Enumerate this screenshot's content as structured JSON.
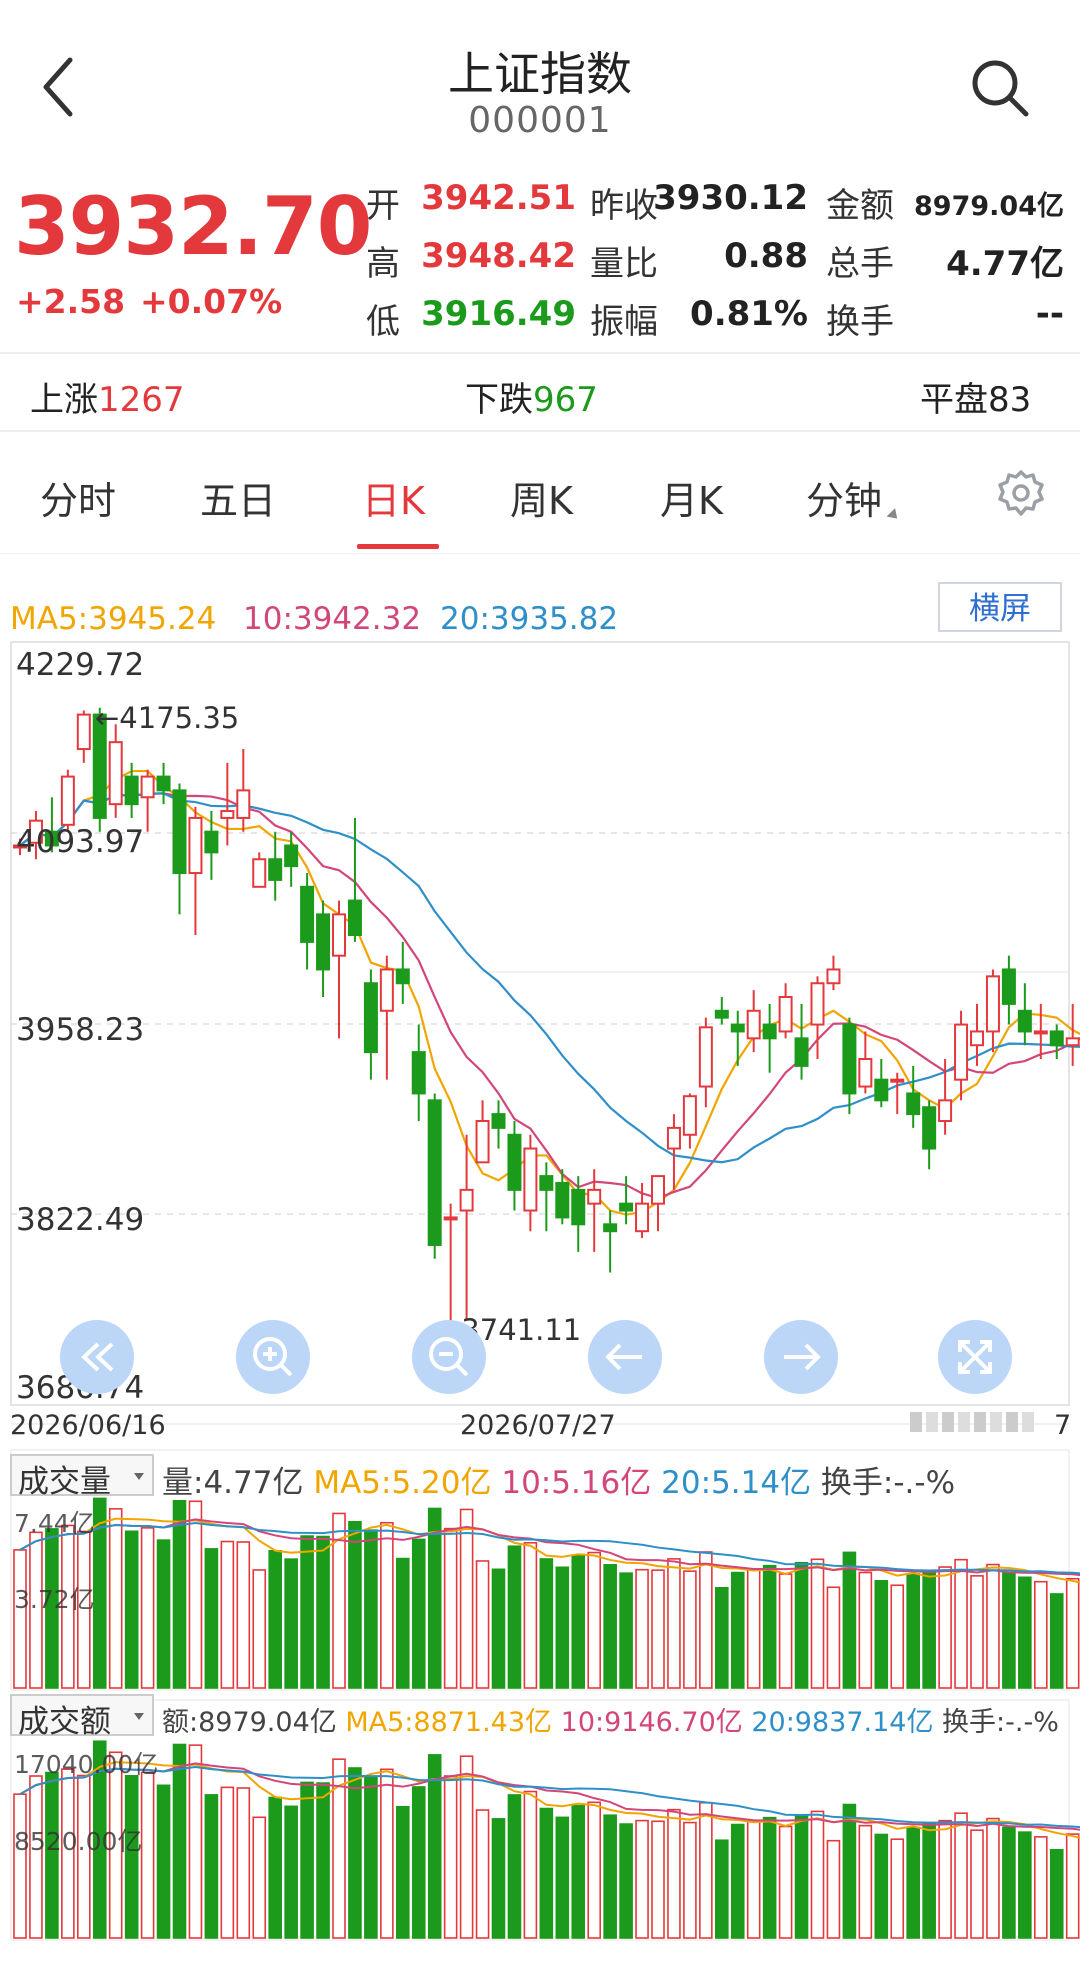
{
  "header": {
    "title": "上证指数",
    "code": "000001"
  },
  "quote": {
    "price": "3932.70",
    "change": "+2.58",
    "change_pct": "+0.07%",
    "fields": [
      {
        "label": "开",
        "value": "3942.51",
        "color": "red"
      },
      {
        "label": "昨收",
        "value": "3930.12",
        "color": "dark"
      },
      {
        "label": "金额",
        "value": "8979.04亿",
        "color": "dark"
      },
      {
        "label": "高",
        "value": "3948.42",
        "color": "red"
      },
      {
        "label": "量比",
        "value": "0.88",
        "color": "dark"
      },
      {
        "label": "总手",
        "value": "4.77亿",
        "color": "dark"
      },
      {
        "label": "低",
        "value": "3916.49",
        "color": "green"
      },
      {
        "label": "振幅",
        "value": "0.81%",
        "color": "dark"
      },
      {
        "label": "换手",
        "value": "--",
        "color": "dark"
      }
    ]
  },
  "advance_decline": {
    "up_label": "上涨",
    "up_value": "1267",
    "down_label": "下跌",
    "down_value": "967",
    "flat_label": "平盘",
    "flat_value": "83"
  },
  "tabs": [
    "分时",
    "五日",
    "日K",
    "周K",
    "月K",
    "分钟"
  ],
  "active_tab": "日K",
  "ma_legend": {
    "ma5": "MA5:3945.24",
    "ma10": "10:3942.32",
    "ma20": "20:3935.82"
  },
  "landscape_label": "横屏",
  "kline": {
    "y_ticks": [
      "4229.72",
      "4093.97",
      "3958.23",
      "3822.49",
      "3686.74"
    ],
    "high_marker": "←4175.35",
    "low_marker": "←3741.11",
    "x_labels": [
      "2026/06/16",
      "2026/07/27"
    ],
    "x_right_fragment": "7"
  },
  "volume": {
    "selector": "成交量",
    "value": "量:4.77亿",
    "ma5": "MA5:5.20亿",
    "ma10": "10:5.16亿",
    "ma20": "20:5.14亿",
    "turnover": "换手:-.-%",
    "ticks": [
      "7.44亿",
      "3.72亿"
    ]
  },
  "amount": {
    "selector": "成交额",
    "value": "额:8979.04亿",
    "ma5": "MA5:8871.43亿",
    "ma10": "10:9146.70亿",
    "ma20": "20:9837.14亿",
    "turnover": "换手:-.-%",
    "ticks": [
      "17040.00亿",
      "8520.00亿"
    ]
  },
  "colors": {
    "up": "#e4393c",
    "down": "#1b9a1b",
    "ma5": "#f0a500",
    "ma10": "#d3467a",
    "ma20": "#2e8fc9",
    "accent": "#2f6fd1"
  },
  "icons": [
    "back-arrow-icon",
    "search-icon",
    "gear-icon",
    "fast-backward-icon",
    "zoom-in-icon",
    "zoom-out-icon",
    "arrow-left-icon",
    "arrow-right-icon",
    "fullscreen-icon",
    "dropdown-caret-icon"
  ],
  "candles": [
    [
      4089,
      4090,
      4095,
      4083
    ],
    [
      4092,
      4108,
      4115,
      4080
    ],
    [
      4100,
      4090,
      4125,
      4085
    ],
    [
      4105,
      4140,
      4145,
      4100
    ],
    [
      4160,
      4185,
      4188,
      4150
    ],
    [
      4185,
      4110,
      4190,
      4100
    ],
    [
      4120,
      4165,
      4178,
      4110
    ],
    [
      4140,
      4120,
      4150,
      4110
    ],
    [
      4125,
      4140,
      4145,
      4100
    ],
    [
      4140,
      4130,
      4150,
      4120
    ],
    [
      4130,
      4070,
      4135,
      4040
    ],
    [
      4070,
      4110,
      4118,
      4025
    ],
    [
      4100,
      4085,
      4115,
      4065
    ],
    [
      4110,
      4115,
      4150,
      4090
    ],
    [
      4110,
      4130,
      4160,
      4100
    ],
    [
      4060,
      4080,
      4085,
      4060
    ],
    [
      4080,
      4065,
      4100,
      4050
    ],
    [
      4090,
      4075,
      4100,
      4060
    ],
    [
      4060,
      4020,
      4070,
      4000
    ],
    [
      4040,
      4000,
      4050,
      3980
    ],
    [
      4010,
      4040,
      4050,
      3950
    ],
    [
      4050,
      4025,
      4110,
      4020
    ],
    [
      3990,
      3940,
      4000,
      3920
    ],
    [
      3970,
      4000,
      4010,
      3920
    ],
    [
      4000,
      3990,
      4020,
      3975
    ],
    [
      3940,
      3910,
      3960,
      3890
    ],
    [
      3905,
      3800,
      3910,
      3790
    ],
    [
      3820,
      3820,
      3830,
      3745
    ],
    [
      3825,
      3840,
      3880,
      3745
    ],
    [
      3860,
      3890,
      3905,
      3860
    ],
    [
      3895,
      3885,
      3905,
      3870
    ],
    [
      3880,
      3840,
      3890,
      3825
    ],
    [
      3825,
      3870,
      3880,
      3810
    ],
    [
      3850,
      3840,
      3860,
      3810
    ],
    [
      3845,
      3820,
      3855,
      3815
    ],
    [
      3840,
      3815,
      3850,
      3795
    ],
    [
      3830,
      3840,
      3855,
      3795
    ],
    [
      3815,
      3810,
      3825,
      3780
    ],
    [
      3830,
      3825,
      3850,
      3815
    ],
    [
      3810,
      3830,
      3845,
      3805
    ],
    [
      3830,
      3850,
      3850,
      3810
    ],
    [
      3870,
      3885,
      3895,
      3840
    ],
    [
      3880,
      3908,
      3910,
      3870
    ],
    [
      3915,
      3958,
      3965,
      3900
    ],
    [
      3970,
      3965,
      3980,
      3960
    ],
    [
      3960,
      3955,
      3970,
      3930
    ],
    [
      3950,
      3970,
      3985,
      3940
    ],
    [
      3960,
      3950,
      3975,
      3925
    ],
    [
      3955,
      3980,
      3990,
      3950
    ],
    [
      3950,
      3930,
      3975,
      3920
    ],
    [
      3960,
      3990,
      3995,
      3935
    ],
    [
      3990,
      4000,
      4010,
      3985
    ],
    [
      3960,
      3910,
      3965,
      3895
    ],
    [
      3915,
      3935,
      3955,
      3910
    ],
    [
      3920,
      3905,
      3935,
      3900
    ],
    [
      3920,
      3920,
      3925,
      3895
    ],
    [
      3910,
      3895,
      3930,
      3885
    ],
    [
      3900,
      3870,
      3905,
      3855
    ],
    [
      3890,
      3905,
      3935,
      3880
    ],
    [
      3920,
      3960,
      3970,
      3905
    ],
    [
      3945,
      3955,
      3975,
      3930
    ],
    [
      3955,
      3995,
      4000,
      3940
    ],
    [
      4000,
      3975,
      4010,
      3960
    ],
    [
      3970,
      3955,
      3990,
      3945
    ],
    [
      3955,
      3955,
      3975,
      3935
    ],
    [
      3955,
      3945,
      3960,
      3935
    ],
    [
      3945,
      3950,
      3975,
      3930
    ],
    [
      3950,
      3945,
      3965,
      3935
    ]
  ]
}
